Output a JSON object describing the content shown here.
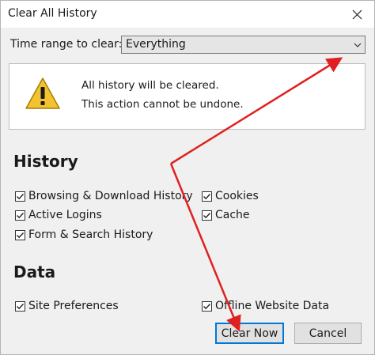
{
  "window": {
    "title": "Clear All History"
  },
  "time_range": {
    "label": "Time range to clear:",
    "value": "Everything"
  },
  "warning": {
    "line1": "All history will be cleared.",
    "line2": "This action cannot be undone."
  },
  "history": {
    "heading": "History",
    "items": [
      {
        "label": "Browsing & Download History",
        "checked": true
      },
      {
        "label": "Cookies",
        "checked": true
      },
      {
        "label": "Active Logins",
        "checked": true
      },
      {
        "label": "Cache",
        "checked": true
      },
      {
        "label": "Form & Search History",
        "checked": true
      }
    ]
  },
  "data": {
    "heading": "Data",
    "items": [
      {
        "label": "Site Preferences",
        "checked": true
      },
      {
        "label": "Offline Website Data",
        "checked": true
      }
    ]
  },
  "buttons": {
    "clear_now": "Clear Now",
    "cancel": "Cancel"
  },
  "colors": {
    "annotation_arrow": "#e02020",
    "primary_border": "#0078d7",
    "warning_yellow": "#f2c230"
  }
}
